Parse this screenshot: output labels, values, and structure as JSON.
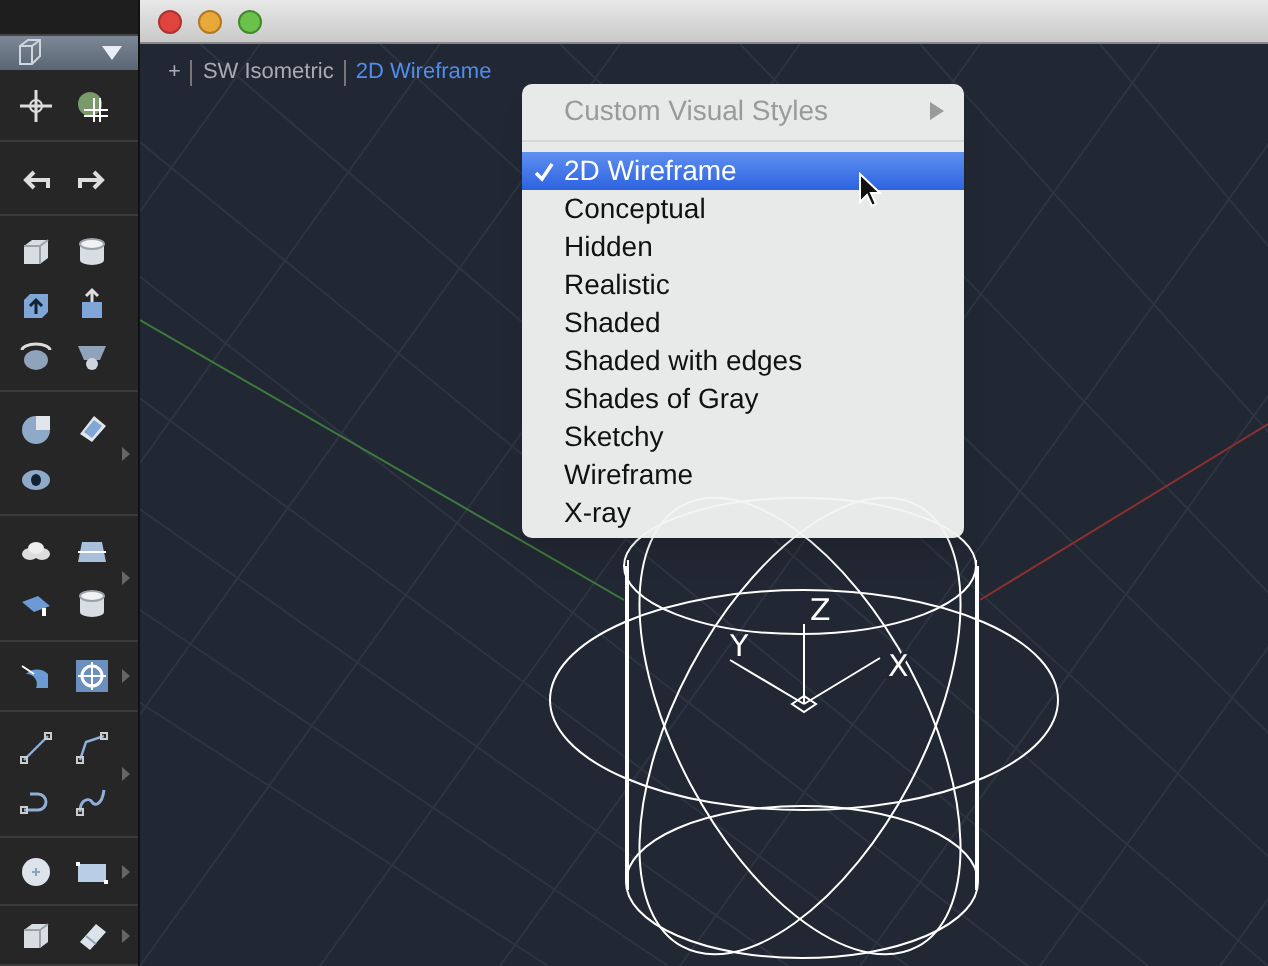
{
  "viewport_controls": [
    {
      "text": "+",
      "selected": false
    },
    {
      "text": "SW Isometric",
      "selected": false
    },
    {
      "text": "2D Wireframe",
      "selected": true
    }
  ],
  "visual_styles_menu": {
    "header": {
      "label": "Custom Visual Styles",
      "disabled": true
    },
    "items": [
      {
        "label": "2D Wireframe",
        "selected": true
      },
      {
        "label": "Conceptual",
        "selected": false
      },
      {
        "label": "Hidden",
        "selected": false
      },
      {
        "label": "Realistic",
        "selected": false
      },
      {
        "label": "Shaded",
        "selected": false
      },
      {
        "label": "Shaded with edges",
        "selected": false
      },
      {
        "label": "Shades of Gray",
        "selected": false
      },
      {
        "label": "Sketchy",
        "selected": false
      },
      {
        "label": "Wireframe",
        "selected": false
      },
      {
        "label": "X-ray",
        "selected": false
      }
    ]
  },
  "ucs_icon": {
    "axis_labels": [
      "Z",
      "Y",
      "X"
    ]
  }
}
